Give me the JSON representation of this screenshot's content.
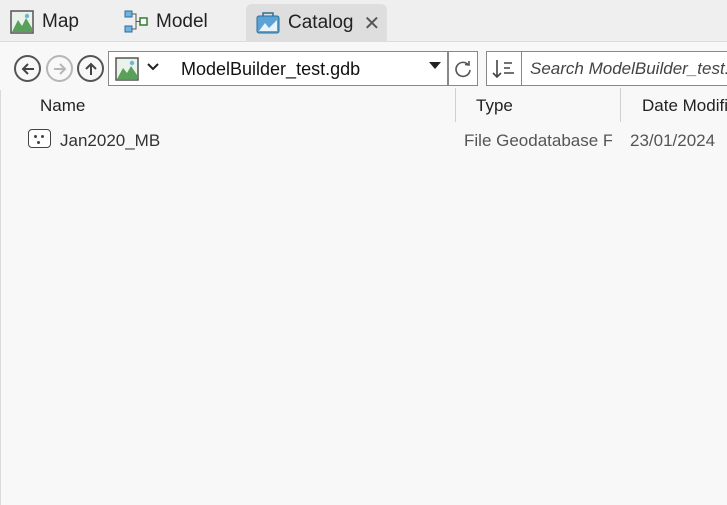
{
  "tabs": [
    {
      "label": "Map",
      "icon": "map-icon"
    },
    {
      "label": "Model",
      "icon": "model-icon"
    },
    {
      "label": "Catalog",
      "icon": "catalog-icon",
      "close": "✕"
    }
  ],
  "toolbar": {
    "location": "ModelBuilder_test.gdb",
    "search_placeholder": "Search ModelBuilder_test.gdb"
  },
  "columns": {
    "name": "Name",
    "type": "Type",
    "date": "Date Modified"
  },
  "items": [
    {
      "name": "Jan2020_MB",
      "type": "File Geodatabase Feature Dataset",
      "date": "23/01/2024"
    }
  ],
  "colors": {
    "accent": "#2e7d32",
    "tab_active": "#dedede",
    "background": "#f8f8f8"
  }
}
